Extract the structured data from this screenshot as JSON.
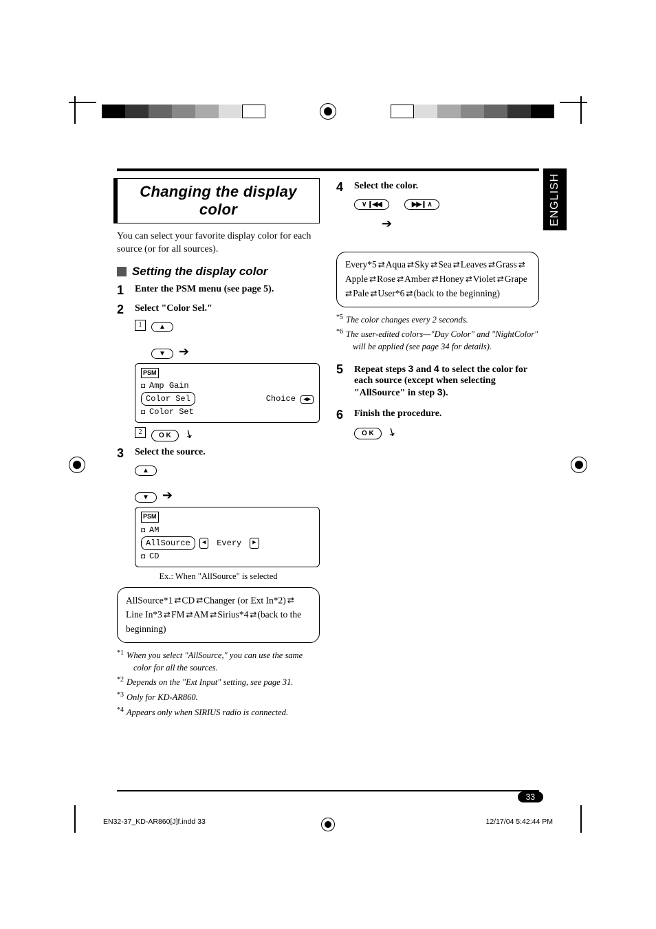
{
  "language_tab": "ENGLISH",
  "page_number": "33",
  "footer": {
    "file": "EN32-37_KD-AR860[J]f.indd   33",
    "timestamp": "12/17/04   5:42:44 PM"
  },
  "title": "Changing the display color",
  "intro": "You can select your favorite display color for each source (or for all sources).",
  "subheading": "Setting the display color",
  "steps": {
    "s1": {
      "num": "1",
      "text": "Enter the PSM menu (see page 5)."
    },
    "s2": {
      "num": "2",
      "text": "Select \"Color Sel.\""
    },
    "s3": {
      "num": "3",
      "text": "Select the source."
    },
    "s4": {
      "num": "4",
      "text": "Select the color."
    },
    "s5": {
      "num": "5",
      "text_a": "Repeat steps ",
      "bold3": "3",
      "text_b": " and ",
      "bold4": "4",
      "text_c": " to select the color for each source (except when selecting \"AllSource\" in step ",
      "bold3b": "3",
      "text_d": ")."
    },
    "s6": {
      "num": "6",
      "text": "Finish the procedure."
    }
  },
  "lcd1": {
    "tag": "PSM",
    "row1": "Amp Gain",
    "row2_sel": "Color Sel",
    "row2_right": "Choice",
    "row3": "Color Set"
  },
  "lcd2": {
    "tag": "PSM",
    "row1": "AM",
    "row2_sel": "AllSource",
    "row2_right": "Every",
    "row3": "CD"
  },
  "lcd2_caption": "Ex.: When \"AllSource\" is selected",
  "sources_box": {
    "items": [
      "AllSource*1",
      "CD",
      "Changer (or Ext In*2)",
      "Line In*3",
      "FM",
      "AM",
      "Sirius*4"
    ],
    "tail": "(back to the beginning)"
  },
  "colors_box": {
    "items": [
      "Every*5",
      "Aqua",
      "Sky",
      "Sea",
      "Leaves",
      "Grass",
      "Apple",
      "Rose",
      "Amber",
      "Honey",
      "Violet",
      "Grape",
      "Pale",
      "User*6"
    ],
    "tail": "(back to the beginning)"
  },
  "footnotes_left": [
    {
      "mark": "*1",
      "text": "When you select \"AllSource,\" you can use the same color for all the sources."
    },
    {
      "mark": "*2",
      "text": "Depends on the \"Ext Input\" setting, see page 31."
    },
    {
      "mark": "*3",
      "text": "Only for KD-AR860."
    },
    {
      "mark": "*4",
      "text": "Appears only when SIRIUS radio is connected."
    }
  ],
  "footnotes_right": [
    {
      "mark": "*5",
      "text": "The color changes every 2 seconds."
    },
    {
      "mark": "*6",
      "text": "The user-edited colors—\"Day Color\" and \"NightColor\" will be applied (see page 34 for details)."
    }
  ],
  "buttons": {
    "ok": "O K"
  },
  "circled": {
    "one": "1",
    "two": "2"
  }
}
